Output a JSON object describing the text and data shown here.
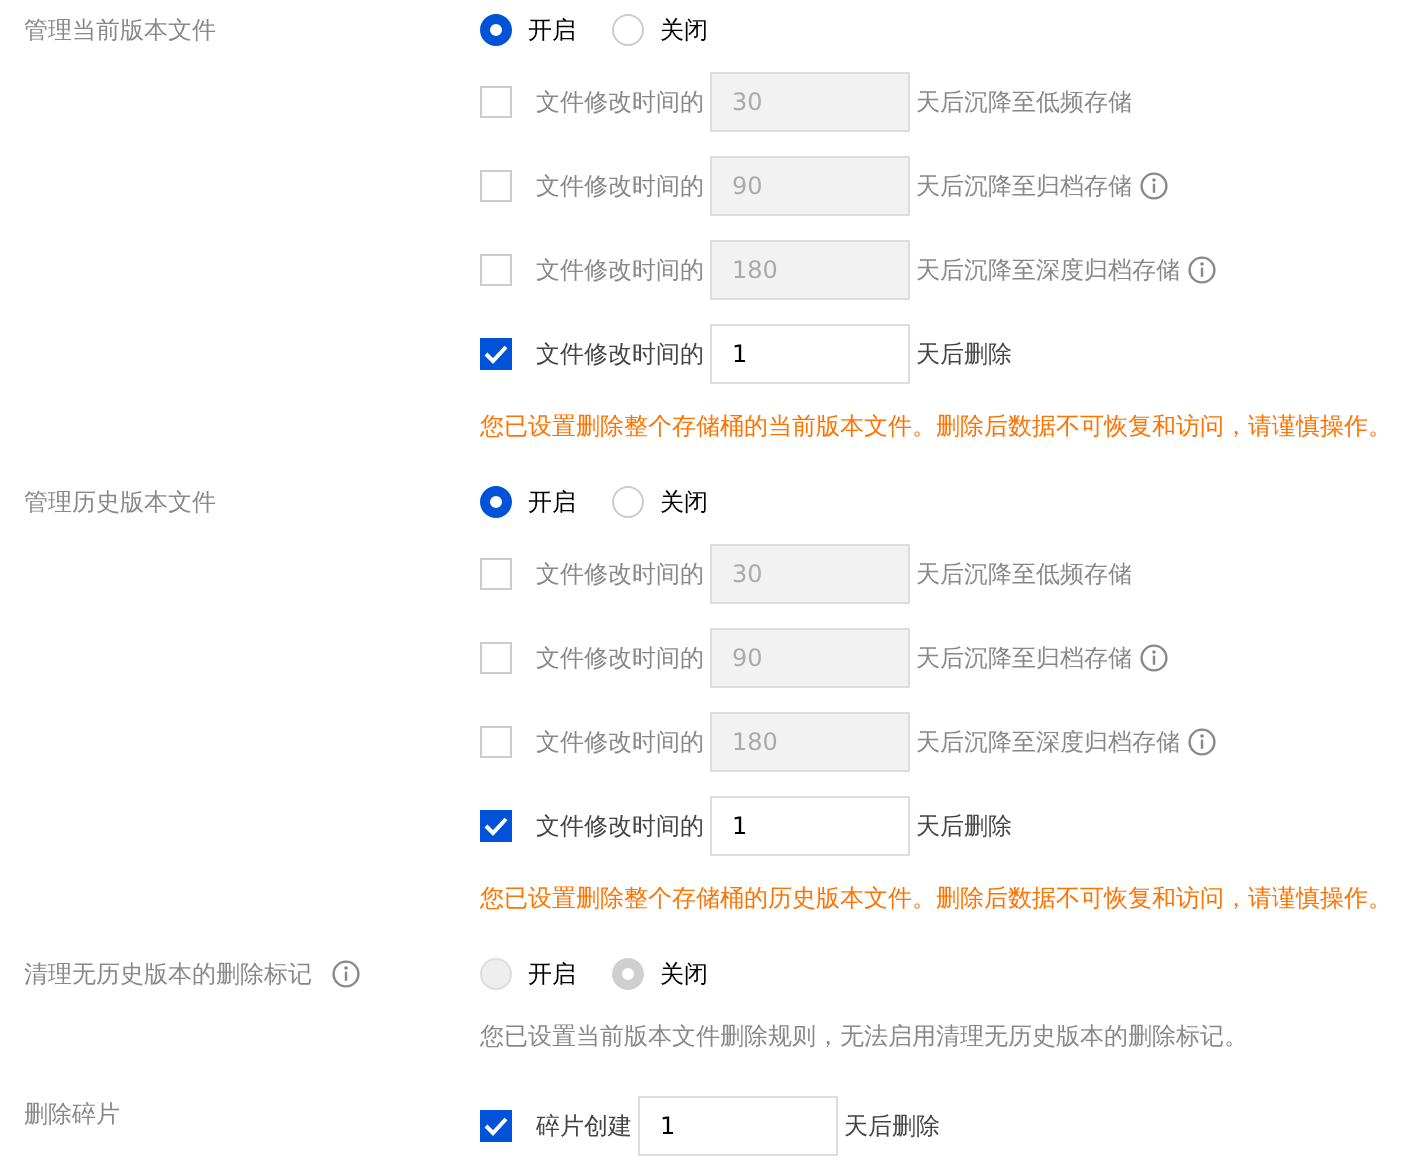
{
  "sections": [
    {
      "label": "管理当前版本文件",
      "radios": [
        {
          "label": "开启",
          "selected": true,
          "disabled": false
        },
        {
          "label": "关闭",
          "selected": false,
          "disabled": false
        }
      ],
      "rules": [
        {
          "checked": false,
          "prefix": "文件修改时间的",
          "value": "30",
          "suffix": "天后沉降至低频存储"
        },
        {
          "checked": false,
          "prefix": "文件修改时间的",
          "value": "90",
          "suffix": "天后沉降至归档存储",
          "info": true
        },
        {
          "checked": false,
          "prefix": "文件修改时间的",
          "value": "180",
          "suffix": "天后沉降至深度归档存储",
          "info": true
        },
        {
          "checked": true,
          "prefix": "文件修改时间的",
          "value": "1",
          "suffix": "天后删除"
        }
      ],
      "note": {
        "kind": "warning",
        "text": "您已设置删除整个存储桶的当前版本文件。删除后数据不可恢复和访问，请谨慎操作。"
      }
    },
    {
      "label": "管理历史版本文件",
      "radios": [
        {
          "label": "开启",
          "selected": true,
          "disabled": false
        },
        {
          "label": "关闭",
          "selected": false,
          "disabled": false
        }
      ],
      "rules": [
        {
          "checked": false,
          "prefix": "文件修改时间的",
          "value": "30",
          "suffix": "天后沉降至低频存储"
        },
        {
          "checked": false,
          "prefix": "文件修改时间的",
          "value": "90",
          "suffix": "天后沉降至归档存储",
          "info": true
        },
        {
          "checked": false,
          "prefix": "文件修改时间的",
          "value": "180",
          "suffix": "天后沉降至深度归档存储",
          "info": true
        },
        {
          "checked": true,
          "prefix": "文件修改时间的",
          "value": "1",
          "suffix": "天后删除"
        }
      ],
      "note": {
        "kind": "warning",
        "text": "您已设置删除整个存储桶的历史版本文件。删除后数据不可恢复和访问，请谨慎操作。"
      }
    },
    {
      "label": "清理无历史版本的删除标记",
      "info": true,
      "radios": [
        {
          "label": "开启",
          "selected": false,
          "disabled": true
        },
        {
          "label": "关闭",
          "selected": true,
          "disabled": true
        }
      ],
      "note": {
        "kind": "hint",
        "text": "您已设置当前版本文件删除规则，无法启用清理无历史版本的删除标记。"
      }
    },
    {
      "label": "删除碎片",
      "rules": [
        {
          "checked": true,
          "prefix": "碎片创建",
          "value": "1",
          "suffix": "天后删除"
        }
      ]
    }
  ]
}
